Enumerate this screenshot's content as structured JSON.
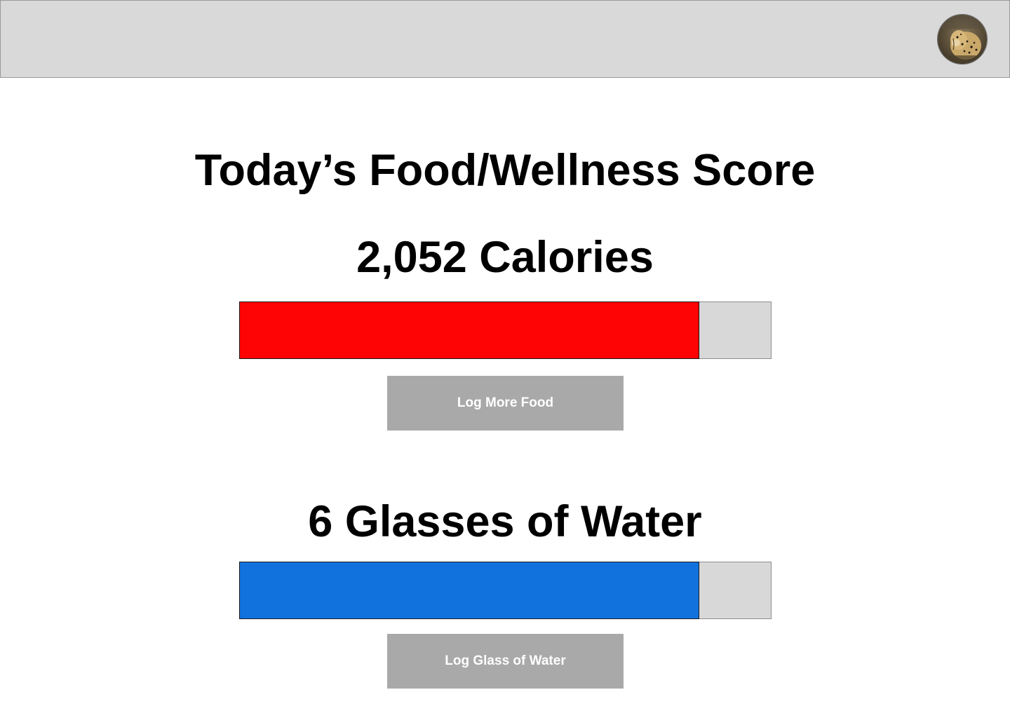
{
  "header": {
    "avatar_icon": "cheetah-profile-photo"
  },
  "main": {
    "title": "Today’s Food/Wellness Score",
    "calories": {
      "label": "2,052 Calories",
      "progress": 0.864,
      "fill_color": "#fe0405",
      "button_label": "Log More Food"
    },
    "water": {
      "label": "6 Glasses of Water",
      "progress": 0.864,
      "fill_color": "#1172de",
      "button_label": "Log Glass of Water"
    }
  },
  "colors": {
    "header_bg": "#d9d9d9",
    "track_bg": "#d8d8d8",
    "button_bg": "#a9a9a9",
    "button_text": "#ffffff"
  }
}
